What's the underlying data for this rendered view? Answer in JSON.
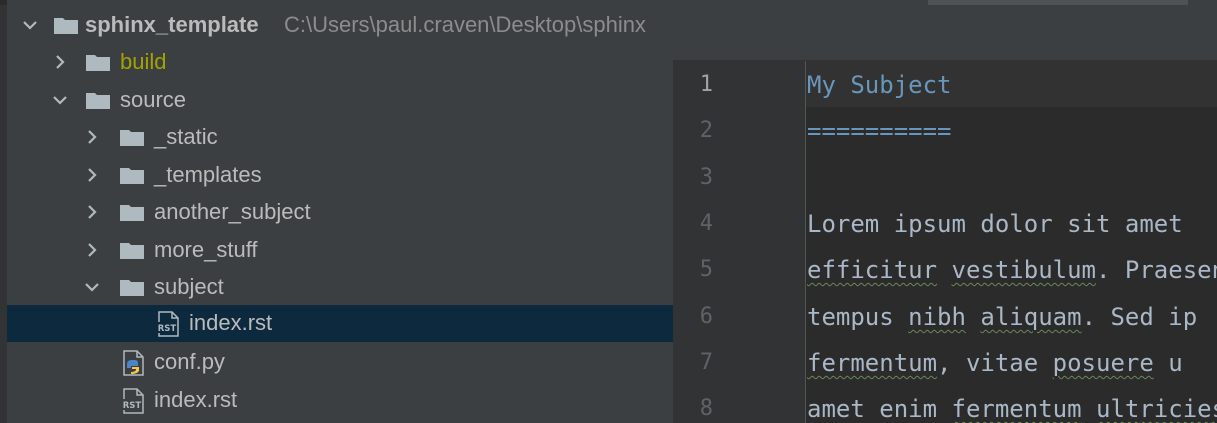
{
  "tree": {
    "root": {
      "name": "sphinx_template",
      "path": "C:\\Users\\paul.craven\\Desktop\\sphinx"
    },
    "items": [
      {
        "label": "build"
      },
      {
        "label": "source"
      },
      {
        "label": "_static"
      },
      {
        "label": "_templates"
      },
      {
        "label": "another_subject"
      },
      {
        "label": "more_stuff"
      },
      {
        "label": "subject"
      },
      {
        "label": "index.rst"
      },
      {
        "label": "conf.py"
      },
      {
        "label": "index.rst"
      }
    ],
    "icons": {
      "rst": "RST"
    },
    "colors": {
      "selection": "#0d293e",
      "excluded": "#a3a300",
      "folder": "#aeb9c0"
    }
  },
  "editor": {
    "line_numbers": [
      "1",
      "2",
      "3",
      "4",
      "5",
      "6",
      "7",
      "8"
    ],
    "lines": {
      "l1": "My Subject",
      "l2": "==========",
      "l4": "Lorem ipsum dolor sit amet",
      "l5a": "efficitur",
      "l5b": " ",
      "l5c": "vestibulum",
      "l5d": ". Praesent",
      "l6a": "tempus ",
      "l6b": "nibh",
      "l6c": " ",
      "l6d": "aliquam",
      "l6e": ". Sed ip",
      "l7a": "fermentum",
      "l7b": ", vitae ",
      "l7c": "posuere",
      "l7d": " u",
      "l8a": "amet enim ",
      "l8b": "fermentum",
      "l8c": " ",
      "l8d": "ultricies"
    },
    "colors": {
      "heading": "#6897bb",
      "text": "#a9b7c6",
      "background": "#2b2b2b"
    }
  }
}
